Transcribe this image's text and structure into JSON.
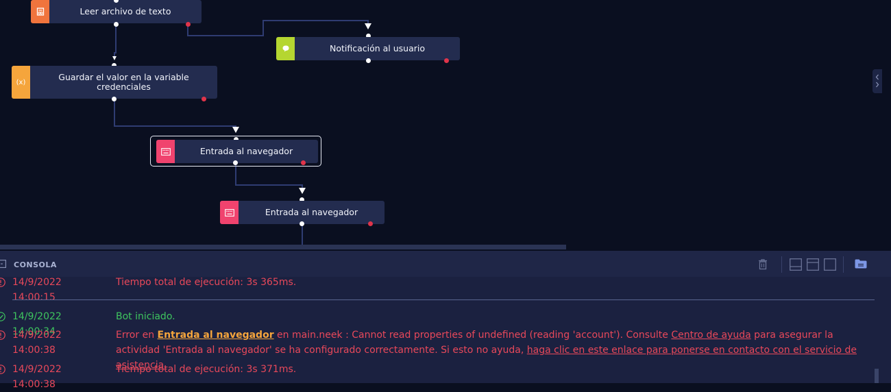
{
  "canvas": {
    "nodes": [
      {
        "id": "leer",
        "label": "Leer archivo de texto",
        "icon": "file-icon",
        "color": "#f0743d"
      },
      {
        "id": "notif",
        "label": "Notificación al usuario",
        "icon": "chat-bubble-icon",
        "color": "#b5d631"
      },
      {
        "id": "guardar",
        "label": "Guardar el valor en la variable credenciales",
        "icon": "variable-icon",
        "icon_text": "(x)",
        "color": "#f5a53c"
      },
      {
        "id": "entrada1",
        "label": "Entrada al navegador",
        "icon": "keyboard-icon",
        "color": "#f0436e"
      },
      {
        "id": "entrada2",
        "label": "Entrada al navegador",
        "icon": "keyboard-icon",
        "color": "#f0436e"
      }
    ]
  },
  "console": {
    "title": "CONSOLA",
    "entries": [
      {
        "status": "error",
        "time": "14/9/2022 14:00:15",
        "message": "Tiempo total de ejecución: 3s 365ms."
      },
      {
        "status": "success",
        "time": "14/9/2022 14:00:34",
        "message": "Bot iniciado."
      },
      {
        "status": "error",
        "time": "14/9/2022 14:00:38",
        "prefix": "Error en ",
        "activity_link": "Entrada al navegador",
        "middle": " en main.neek : Cannot read properties of undefined (reading 'account'). Consulte ",
        "help_link": "Centro de ayuda",
        "middle2": " para asegurar la actividad 'Entrada al navegador' se ha configurado correctamente. Si esto no ayuda, ",
        "support_link": "haga clic en este enlace para ponerse en contacto con el servicio de asistencia."
      },
      {
        "status": "error",
        "time": "14/9/2022 14:00:38",
        "message": "Tiempo total de ejecución: 3s 371ms."
      }
    ]
  },
  "colors": {
    "canvas_bg": "#0a0f20",
    "node_bg": "#232c4f",
    "error": "#e8485a",
    "success": "#3ec45e",
    "link_accent": "#f5a53c"
  }
}
